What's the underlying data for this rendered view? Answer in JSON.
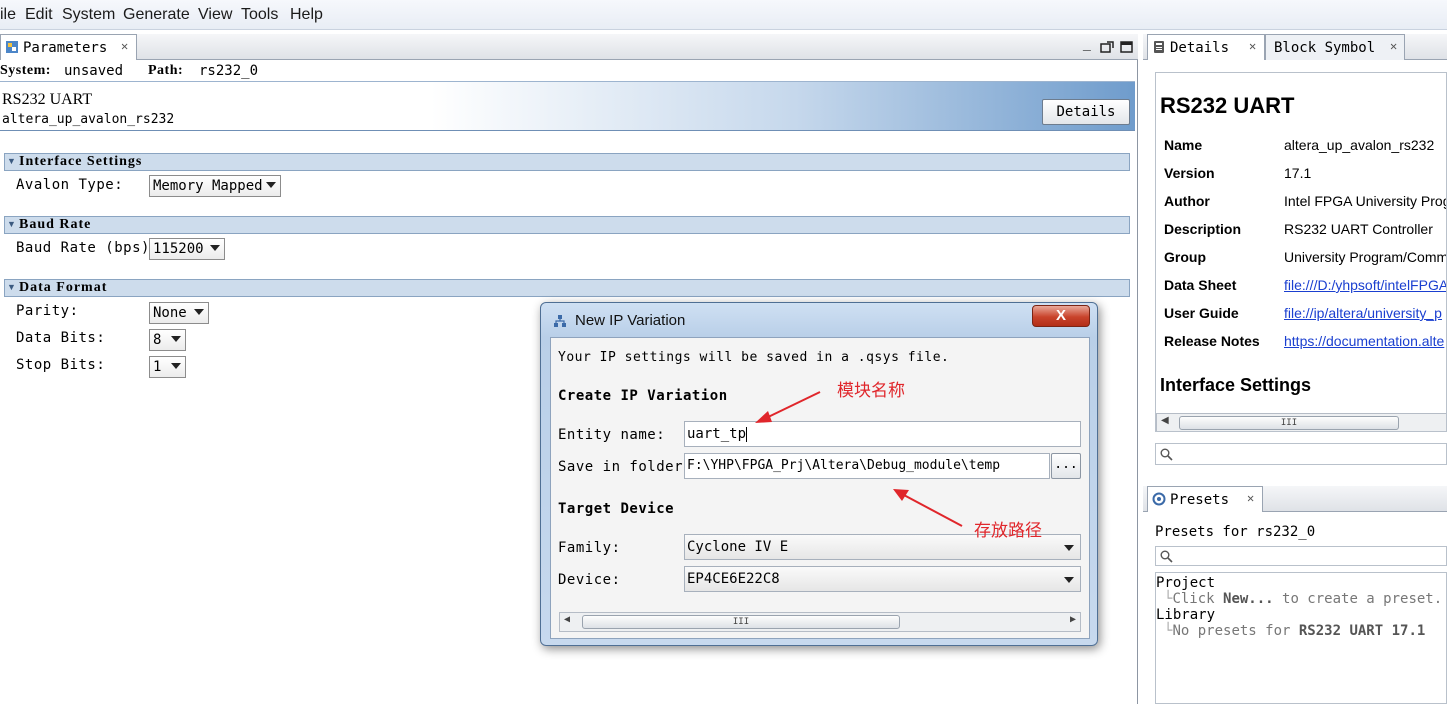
{
  "menubar": {
    "items": [
      "ile",
      "Edit",
      "System",
      "Generate",
      "View",
      "Tools",
      "Help"
    ]
  },
  "parameters_tab": {
    "label": "Parameters"
  },
  "system_line": {
    "system_label": "System:",
    "system_value": "unsaved",
    "path_label": "Path:",
    "path_value": "rs232_0"
  },
  "banner": {
    "title": "RS232 UART",
    "subtitle": "altera_up_avalon_rs232",
    "details_button": "Details"
  },
  "sections": {
    "interface": {
      "title": "Interface Settings",
      "avalon_type_label": "Avalon Type:",
      "avalon_type_value": "Memory Mapped"
    },
    "baud": {
      "title": "Baud Rate",
      "baud_label": "Baud Rate (bps):",
      "baud_value": "115200"
    },
    "format": {
      "title": "Data Format",
      "parity_label": "Parity:",
      "parity_value": "None",
      "data_bits_label": "Data Bits:",
      "data_bits_value": "8",
      "stop_bits_label": "Stop Bits:",
      "stop_bits_value": "1"
    }
  },
  "dialog": {
    "title": "New IP Variation",
    "info": "Your IP settings will be saved in a .qsys file.",
    "create_heading": "Create IP Variation",
    "entity_label": "Entity name:",
    "entity_value": "uart_tp",
    "folder_label": "Save in folder:",
    "folder_value": "F:\\YHP\\FPGA_Prj\\Altera\\Debug_module\\temp",
    "browse_label": "...",
    "target_heading": "Target Device",
    "family_label": "Family:",
    "family_value": "Cyclone IV E",
    "device_label": "Device:",
    "device_value": "EP4CE6E22C8",
    "close_label": "X"
  },
  "annotations": {
    "module_name": "模块名称",
    "save_path": "存放路径"
  },
  "details_panel": {
    "tab_details": "Details",
    "tab_block_symbol": "Block Symbol",
    "heading": "RS232 UART",
    "rows": [
      {
        "key": "Name",
        "value": "altera_up_avalon_rs232"
      },
      {
        "key": "Version",
        "value": "17.1"
      },
      {
        "key": "Author",
        "value": "Intel FPGA University Prog"
      },
      {
        "key": "Description",
        "value": "RS232 UART Controller"
      },
      {
        "key": "Group",
        "value": "University Program/Comm"
      },
      {
        "key": "Data Sheet",
        "value": "file:///D:/yhpsoft/intelFPGA"
      },
      {
        "key": "User Guide",
        "value": "file://ip/altera/university_p"
      },
      {
        "key": "Release Notes",
        "value": "https://documentation.alte"
      }
    ],
    "interface_heading": "Interface Settings"
  },
  "presets_panel": {
    "tab": "Presets",
    "title": "Presets for rs232_0",
    "project_label": "Project",
    "project_hint_a": "Click ",
    "project_hint_b": "New...",
    "project_hint_c": " to create a preset.",
    "library_label": "Library",
    "library_hint_a": "No presets for ",
    "library_hint_b": "RS232 UART 17.1"
  },
  "scrollbar_grip": "III",
  "colors": {
    "accent": "#6f9ccc",
    "annotation": "#e0262b",
    "link": "#1a3fd0",
    "section": "#cddcec"
  }
}
